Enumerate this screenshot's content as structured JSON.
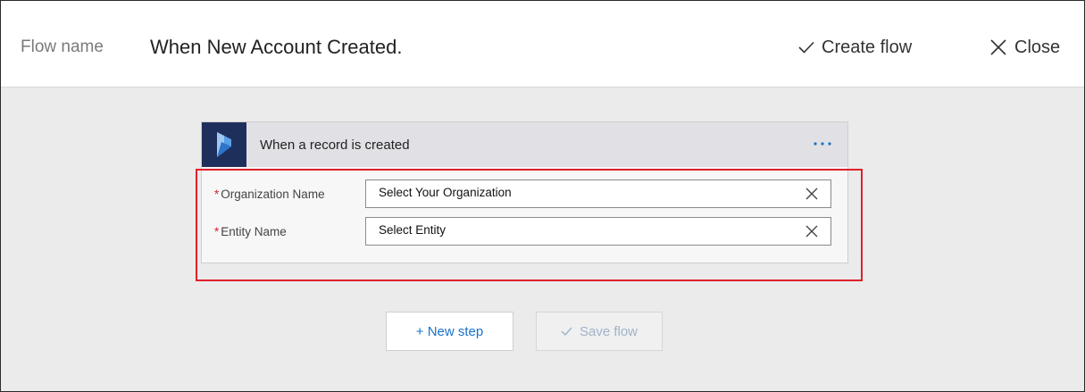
{
  "header": {
    "flow_label": "Flow name",
    "flow_name": "When New Account Created.",
    "create_flow_label": "Create flow",
    "close_label": "Close"
  },
  "trigger_card": {
    "brand_icon": "dynamics-365-icon",
    "title": "When a record is created",
    "more_icon": "ellipsis-icon",
    "fields": [
      {
        "required_marker": "*",
        "label": "Organization Name",
        "value": "Select Your Organization"
      },
      {
        "required_marker": "*",
        "label": "Entity Name",
        "value": "Select Entity"
      }
    ]
  },
  "actions": {
    "new_step_label": "+ New step",
    "save_flow_label": "Save flow"
  },
  "colors": {
    "highlight": "#e0202a",
    "brand_tile": "#1f2f5c",
    "link_blue": "#1a73c8",
    "required": "#d6232c"
  }
}
